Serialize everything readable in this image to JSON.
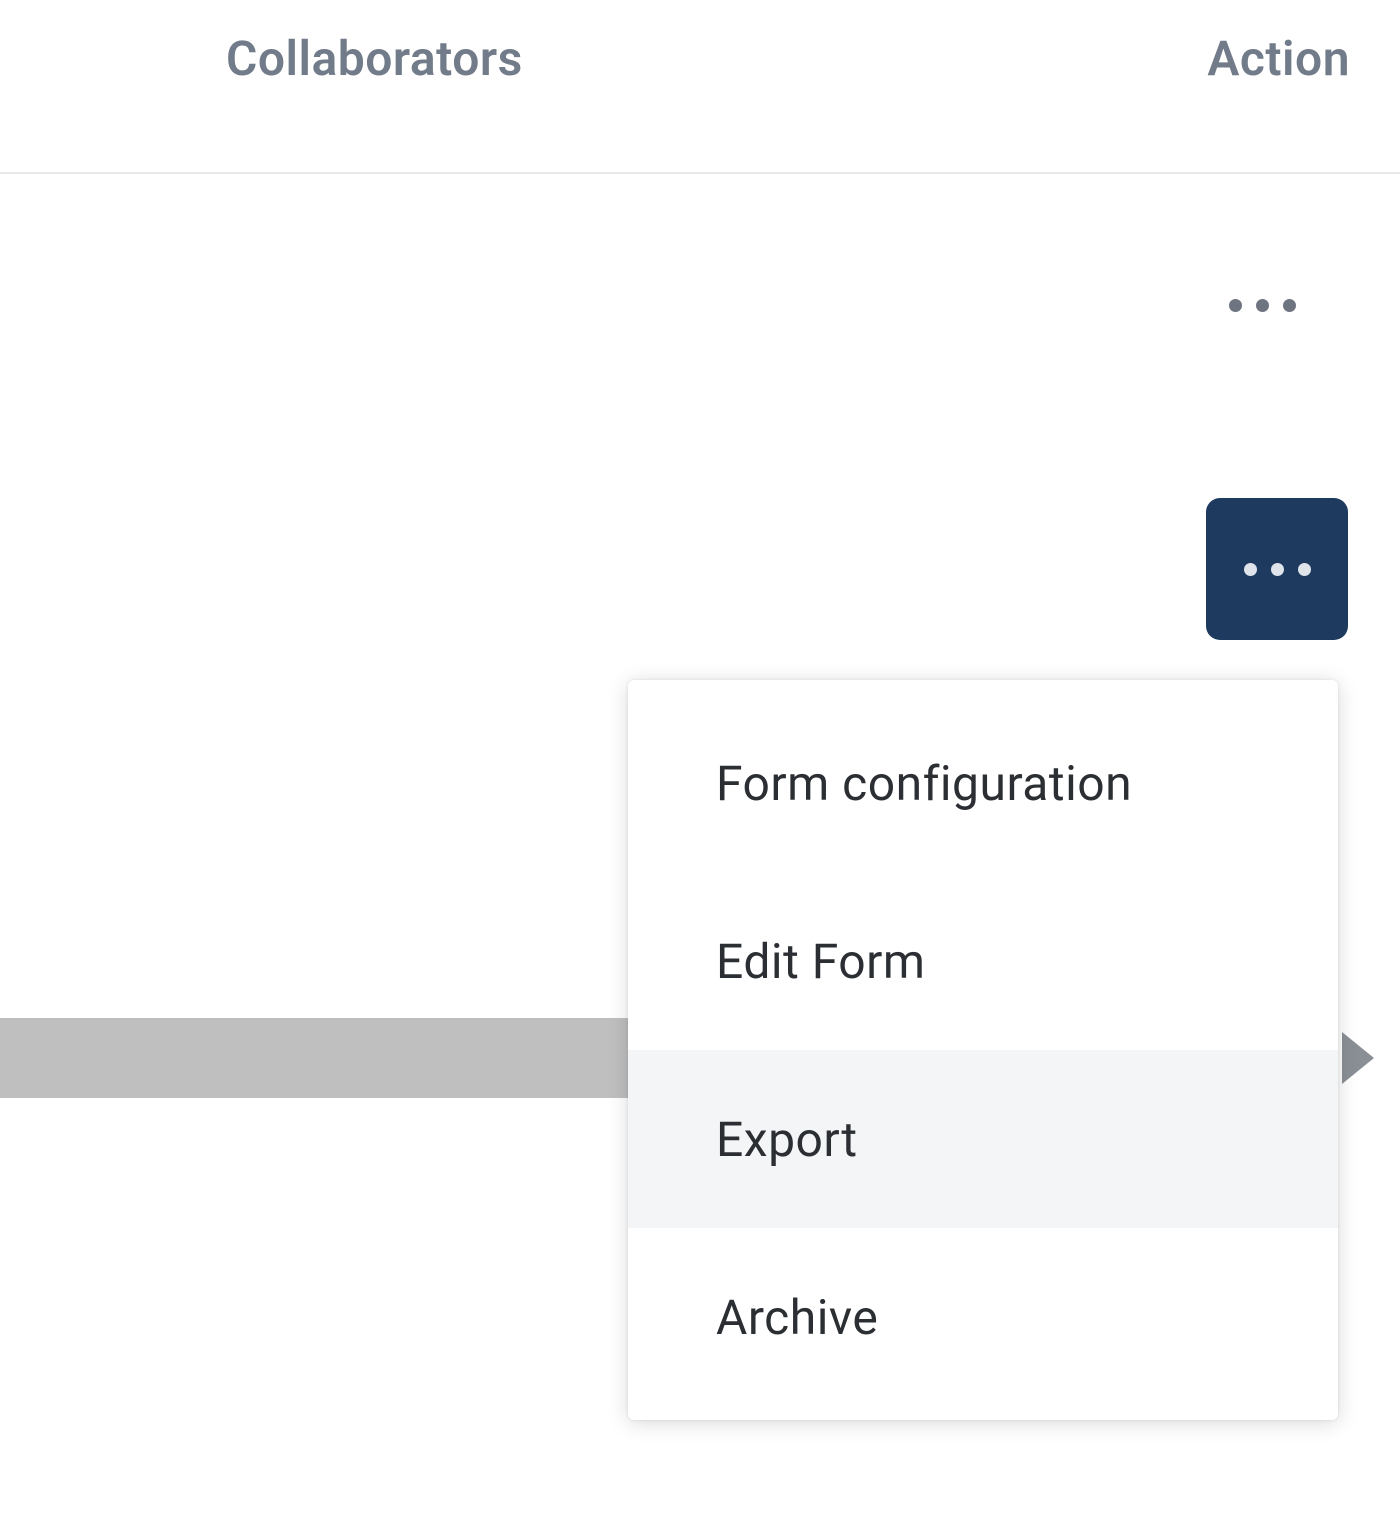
{
  "colors": {
    "header_text": "#717b89",
    "more_box_bg": "#1e3a5f",
    "menu_highlight": "#f4f5f6"
  },
  "header": {
    "collaborators_label": "Collaborators",
    "action_label": "Action"
  },
  "menu": {
    "items": [
      {
        "label": "Form configuration",
        "highlighted": false
      },
      {
        "label": "Edit Form",
        "highlighted": false
      },
      {
        "label": "Export",
        "highlighted": true
      },
      {
        "label": "Archive",
        "highlighted": false
      }
    ]
  }
}
